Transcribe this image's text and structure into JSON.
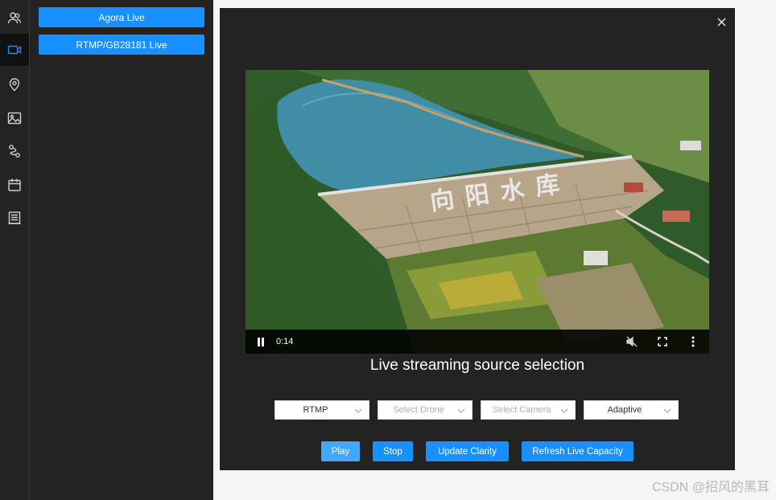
{
  "rail": {
    "items": [
      {
        "icon": "users-icon",
        "name": "rail-item-members"
      },
      {
        "icon": "video-camera-icon",
        "name": "rail-item-livestream",
        "active": true
      },
      {
        "icon": "map-pin-icon",
        "name": "rail-item-map"
      },
      {
        "icon": "image-icon",
        "name": "rail-item-media"
      },
      {
        "icon": "route-icon",
        "name": "rail-item-wayline"
      },
      {
        "icon": "calendar-icon",
        "name": "rail-item-tasks"
      },
      {
        "icon": "list-icon",
        "name": "rail-item-logs"
      }
    ]
  },
  "panel": {
    "agora_label": "Agora Live",
    "rtmp_label": "RTMP/GB28181 Live"
  },
  "modal": {
    "close_icon": "close-icon",
    "video": {
      "overlay_text": "向阳水库",
      "time": "0:14",
      "pause_icon": "pause-icon",
      "mute_icon": "volume-muted-icon",
      "fullscreen_icon": "fullscreen-icon",
      "more_icon": "more-vertical-icon"
    },
    "title": "Live streaming source selection",
    "selects": {
      "protocol": "RTMP",
      "drone_placeholder": "Select Drone",
      "camera_placeholder": "Select Camera",
      "clarity": "Adaptive"
    },
    "buttons": {
      "play": "Play",
      "stop": "Stop",
      "update_clarity": "Update Clarity",
      "refresh_capacity": "Refresh Live Capacity"
    }
  },
  "colors": {
    "accent": "#1890ff",
    "accent_light": "#40a9ff",
    "dark_bg": "#232323"
  },
  "watermark": "CSDN @招风的黑耳"
}
